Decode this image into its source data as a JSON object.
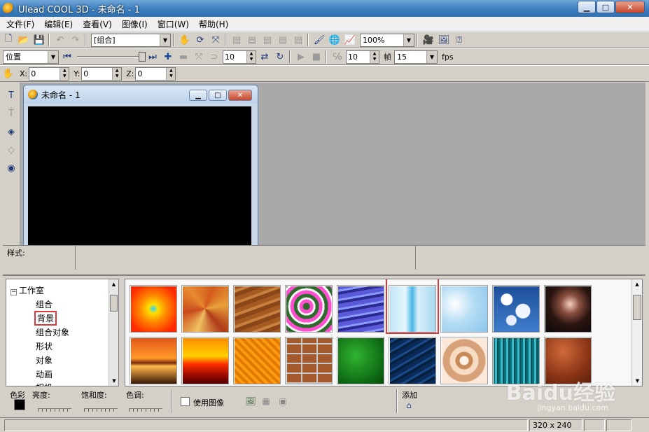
{
  "window": {
    "title": "Ulead COOL 3D - 未命名 - 1",
    "minimize": "▁",
    "maximize": "□",
    "close": "✕"
  },
  "menu": [
    "文件(F)",
    "编辑(E)",
    "查看(V)",
    "图像(I)",
    "窗口(W)",
    "帮助(H)"
  ],
  "toolbar1": {
    "object_combo": "[组合]",
    "zoom_combo": "100%"
  },
  "toolbar2": {
    "mode_combo": "位置",
    "value1": "10",
    "value2": "10",
    "frame_label": "帧",
    "fps_value": "15",
    "fps_label": "fps"
  },
  "toolbar3": {
    "x_label": "X:",
    "x_value": "0",
    "y_label": "Y:",
    "y_value": "0",
    "z_label": "Z:",
    "z_value": "0"
  },
  "document": {
    "title": "未命名 - 1"
  },
  "stylebar": {
    "label": "样式:"
  },
  "tree": {
    "root": "工作室",
    "root_expander": "−",
    "items": [
      "组合",
      "背景",
      "组合对象",
      "形状",
      "对象",
      "动画",
      "相机"
    ],
    "selected": "背景"
  },
  "gallery": {
    "category": "背景",
    "row1": [
      "sunburst-orange",
      "mosaic-autumn",
      "wood-grain",
      "psychedelic-swirl",
      "blue-waves",
      "ice-blue",
      "frost-light",
      "clouds-blue",
      "dark-clouds"
    ],
    "row2": [
      "sunset-sea",
      "sunset-red",
      "orange-pattern",
      "brick-wall",
      "green-texture",
      "blue-water",
      "spiral-peach",
      "teal-stripes",
      "rust-texture"
    ],
    "highlighted": "ice-blue"
  },
  "footer": {
    "color_label": "色彩",
    "brightness_label": "亮度:",
    "saturation_label": "饱和度:",
    "hue_label": "色调:",
    "use_image_label": "使用图像",
    "add_label": "添加",
    "swatch_color": "#000000"
  },
  "status": {
    "resolution": "320 x 240"
  },
  "watermark": {
    "brand": "Baidu经验",
    "site": "jingyan.baidu.com"
  },
  "colors": {
    "highlight_red": "#d9393a",
    "workspace_gray": "#a9a9a9"
  }
}
